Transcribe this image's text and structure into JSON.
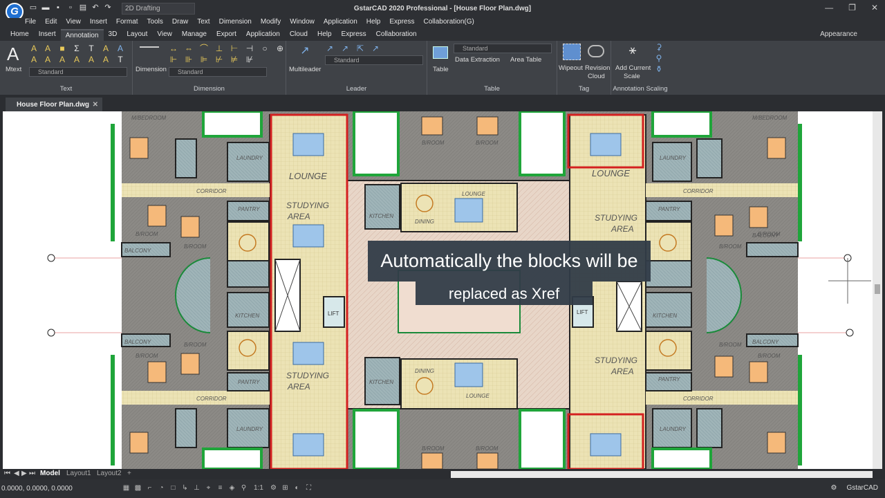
{
  "app": {
    "title": "GstarCAD 2020 Professional - [House Floor Plan.dwg]",
    "workspace": "2D Drafting",
    "logo_letter": "G"
  },
  "menu": [
    "File",
    "Edit",
    "View",
    "Insert",
    "Format",
    "Tools",
    "Draw",
    "Text",
    "Dimension",
    "Modify",
    "Window",
    "Application",
    "Help",
    "Express",
    "Collaboration(G)"
  ],
  "ribbon_tabs": [
    "Home",
    "Insert",
    "Annotation",
    "3D",
    "Layout",
    "View",
    "Manage",
    "Export",
    "Application",
    "Cloud",
    "Help",
    "Express",
    "Collaboration"
  ],
  "active_tab": "Annotation",
  "appearance": "Appearance",
  "ribbon": {
    "text_panel": {
      "label": "Text",
      "mtext": "Mtext",
      "style": "Standard"
    },
    "dimension_panel": {
      "label": "Dimension",
      "button": "Dimension",
      "style": "Standard"
    },
    "leader_panel": {
      "label": "Leader",
      "button": "Multileader",
      "style": "Standard"
    },
    "table_panel": {
      "label": "Table",
      "button": "Table",
      "style": "Standard",
      "data_extraction": "Data Extraction",
      "area_table": "Area Table"
    },
    "tag_panel": {
      "label": "Tag",
      "wipeout": "Wipeout",
      "revision_cloud_1": "Revision",
      "revision_cloud_2": "Cloud"
    },
    "scaling_panel": {
      "label": "Annotation Scaling",
      "add_current_1": "Add Current",
      "add_current_2": "Scale"
    }
  },
  "document_tab": "House Floor Plan.dwg",
  "layout_tabs": [
    "Model",
    "Layout1",
    "Layout2"
  ],
  "coordinates": "0.0000, 0.0000, 0.0000",
  "status_right": "GstarCAD",
  "scale": "1:1",
  "caption": {
    "line1": "Automatically the blocks will be",
    "line2": "replaced as Xref"
  },
  "plan_labels": {
    "lounge": "LOUNGE",
    "studying": "STUDYING",
    "area": "AREA",
    "corridor": "CORRIDOR",
    "pantry": "PANTRY",
    "laundry": "LAUNDRY",
    "bedroom": "B/ROOM",
    "mbedroom": "M/BEDROOM",
    "balcony": "BALCONY",
    "kitchen": "KITCHEN",
    "dining": "DINING",
    "lift": "LIFT"
  },
  "colors": {
    "xref_highlight": "#d42020",
    "wall": "#1a1a1a",
    "floor_tile": "#ece3b5",
    "room_fill": "#8c8c8c",
    "hall_fill": "#e8d6c8",
    "green": "#1fa53a",
    "bed": "#f5b97a",
    "sofa": "#9ec5ea"
  }
}
